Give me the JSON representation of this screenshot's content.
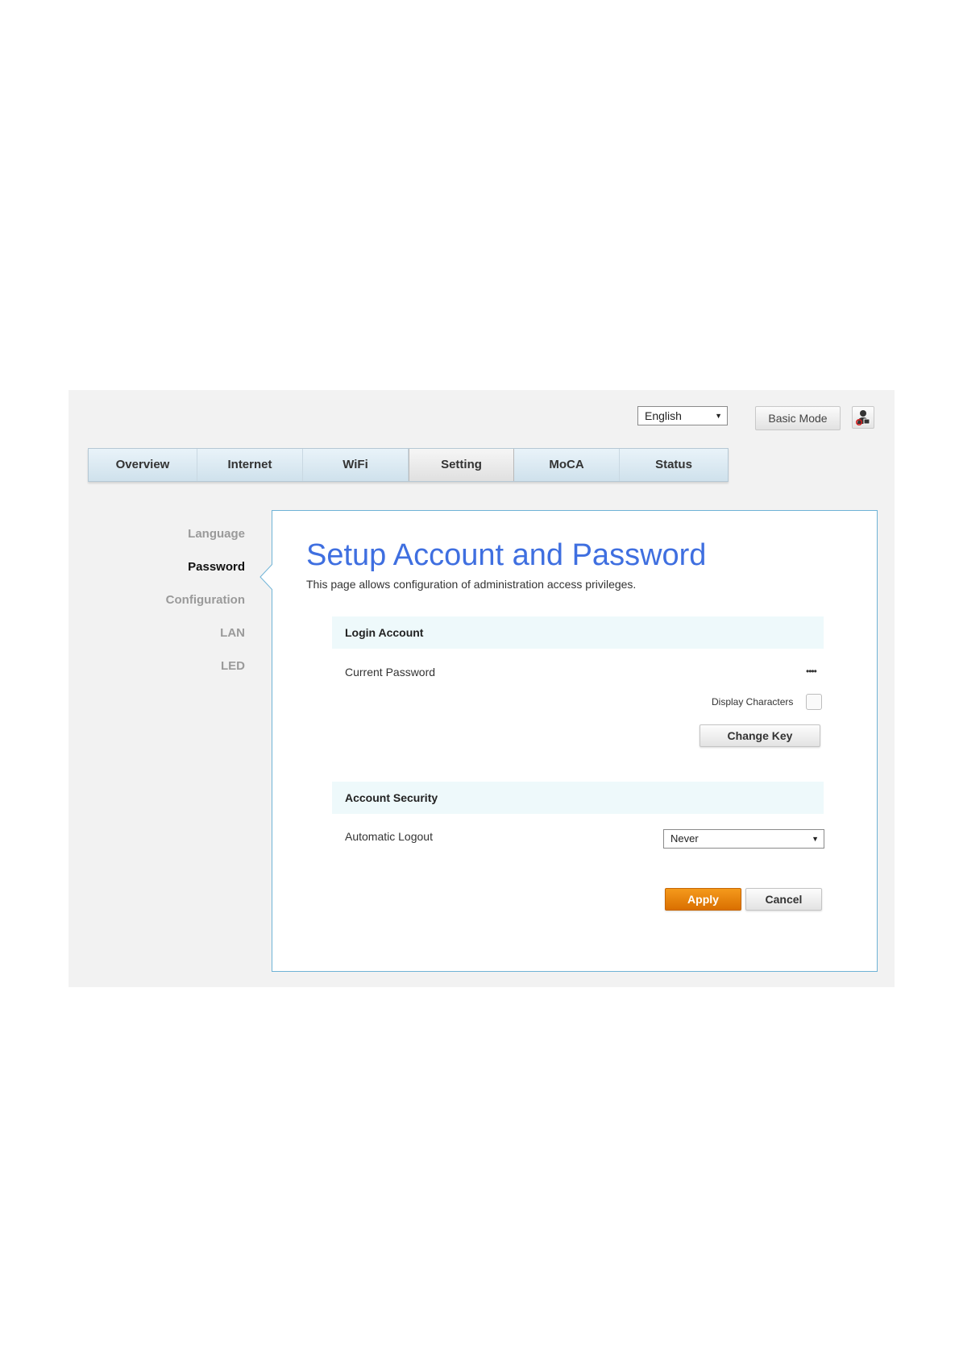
{
  "header": {
    "language": "English",
    "basic_mode_label": "Basic Mode"
  },
  "tabs": [
    {
      "label": "Overview"
    },
    {
      "label": "Internet"
    },
    {
      "label": "WiFi"
    },
    {
      "label": "Setting",
      "active": true
    },
    {
      "label": "MoCA"
    },
    {
      "label": "Status"
    }
  ],
  "sidebar": {
    "items": [
      {
        "label": "Language"
      },
      {
        "label": "Password",
        "active": true
      },
      {
        "label": "Configuration"
      },
      {
        "label": "LAN"
      },
      {
        "label": "LED"
      }
    ]
  },
  "main": {
    "title": "Setup Account and Password",
    "subtitle": "This page allows configuration of administration access privileges.",
    "login_account": {
      "heading": "Login Account",
      "current_password_label": "Current Password",
      "current_password_value": "••••",
      "display_characters_label": "Display Characters",
      "change_key_label": "Change Key"
    },
    "account_security": {
      "heading": "Account Security",
      "automatic_logout_label": "Automatic Logout",
      "automatic_logout_value": "Never"
    },
    "apply_label": "Apply",
    "cancel_label": "Cancel"
  },
  "colors": {
    "accent_blue": "#3f6fe0",
    "apply_orange": "#e57f0b",
    "content_border": "#6fb3d6"
  }
}
